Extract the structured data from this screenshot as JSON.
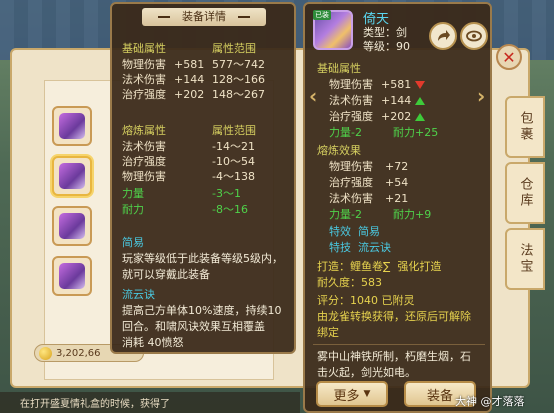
{
  "left_panel": {
    "title": "装备详情",
    "base_header": "基础属性",
    "base_range_header": "属性范围",
    "base_stats": [
      {
        "name": "物理伤害",
        "value": "+581",
        "range": "577～742"
      },
      {
        "name": "法术伤害",
        "value": "+144",
        "range": "128～166"
      },
      {
        "name": "治疗强度",
        "value": "+202",
        "range": "148～267"
      }
    ],
    "forge_header": "熔炼属性",
    "forge_range_header": "属性范围",
    "forge_stats": [
      {
        "name": "法术伤害",
        "range": "-14～21"
      },
      {
        "name": "治疗强度",
        "range": "-10～54"
      },
      {
        "name": "物理伤害",
        "range": "-4～138"
      },
      {
        "name": "力量",
        "range": "-3～1"
      },
      {
        "name": "耐力",
        "range": "-8～16"
      }
    ],
    "easy_header": "简易",
    "easy_text_1": "玩家等级低于此装备等级5级内，",
    "easy_text_2": "就可以穿戴此装备",
    "skill_name": "流云诀",
    "skill_text_1": "提高己方单体10%速度，持续10",
    "skill_text_2": "回合。和啸风诀效果互相覆盖",
    "skill_cost": "消耗  40愤怒"
  },
  "right_panel": {
    "badge": "已装",
    "item_name": "倚天",
    "type_line": "类型：剑",
    "level_line": "等级：90",
    "base_header": "基础属性",
    "base_stats": [
      {
        "name": "物理伤害",
        "value": "+581",
        "trend": "down"
      },
      {
        "name": "法术伤害",
        "value": "+144",
        "trend": "up"
      },
      {
        "name": "治疗强度",
        "value": "+202",
        "trend": "up"
      }
    ],
    "base_extra_1": "力量-2",
    "base_extra_2": "耐力+25",
    "forge_header": "熔炼效果",
    "forge_stats": [
      {
        "name": "物理伤害",
        "value": "+72"
      },
      {
        "name": "治疗强度",
        "value": "+54"
      },
      {
        "name": "法术伤害",
        "value": "+21"
      }
    ],
    "forge_extra_1": "力量-2",
    "forge_extra_2": "耐力+9",
    "special_label": "特效",
    "special_value": "简易",
    "skill_label": "特技",
    "skill_value": "流云诀",
    "forged_by_label": "打造：",
    "forged_by_value": "鲤鱼卷∑",
    "forge_type": "强化打造",
    "durability": "耐久度：583",
    "score": "评分：1040  已附灵",
    "bind_1": "由龙雀转换获得，还原后可解除",
    "bind_2": "绑定",
    "desc_1": "雾中山神铁所制，朽磨生烟，石",
    "desc_2": "击火起，剑光如电。",
    "more_button": "更多",
    "equip_button": "装备"
  },
  "side_tabs": [
    "包裹",
    "仓库",
    "法宝"
  ],
  "money": "3,202,66",
  "chat_text": "在打开盛夏情礼盒的时候，获得了",
  "watermark": "大神 @才落落"
}
